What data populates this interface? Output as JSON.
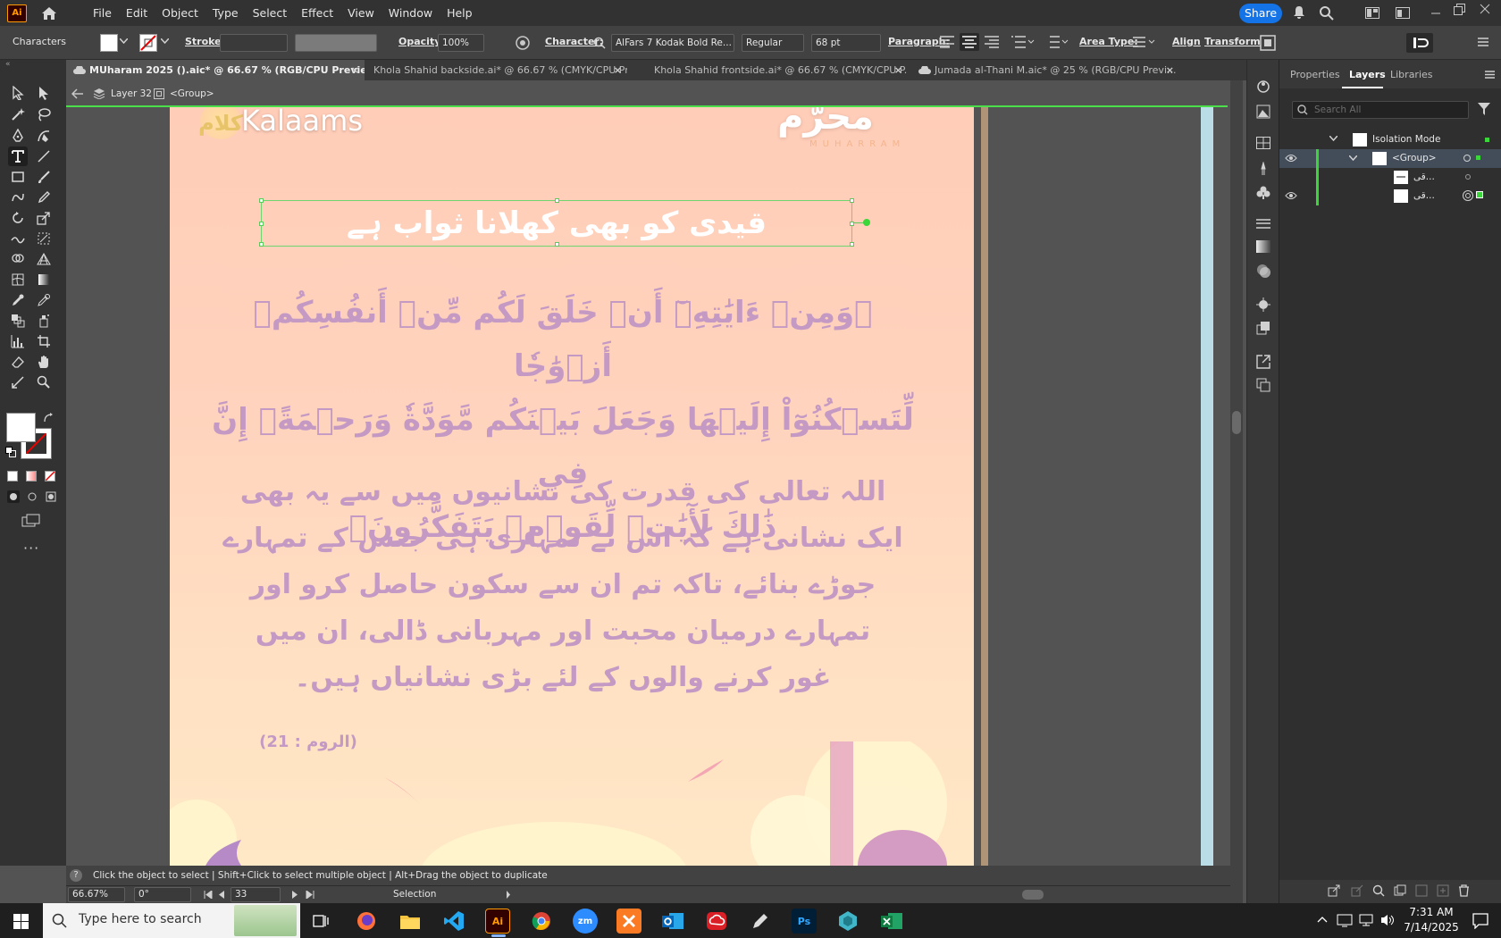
{
  "app": {
    "logo_text": "Ai"
  },
  "menu": [
    "File",
    "Edit",
    "Object",
    "Type",
    "Select",
    "Effect",
    "View",
    "Window",
    "Help"
  ],
  "share_label": "Share",
  "control_bar": {
    "panel_label": "Characters",
    "stroke_label": "Stroke:",
    "opacity_label": "Opacity:",
    "opacity_value": "100%",
    "character_label": "Character:",
    "font_name": "AlFars 7 Kodak Bold Re...",
    "font_style": "Regular",
    "font_size": "68 pt",
    "paragraph_label": "Paragraph:",
    "area_type_label": "Area Type:",
    "align_label": "Align",
    "transform_label": "Transform"
  },
  "tabs": [
    {
      "label": "MUharam 2025 ().aic* @ 66.67 % (RGB/CPU Preview)",
      "active": true
    },
    {
      "label": "Khola Shahid backside.ai* @ 66.67 % (CMYK/CPU Pr...",
      "active": false
    },
    {
      "label": "Khola Shahid frontside.ai* @ 66.67 % (CMYK/CPU P...",
      "active": false
    },
    {
      "label": "Jumada al-Thani M.aic* @ 25 % (RGB/CPU Previ...",
      "active": false
    }
  ],
  "breadcrumb": {
    "layer": "Layer 32",
    "group": "<Group>"
  },
  "artboard": {
    "brand": "Kalaams",
    "brand_urdu": "کلام",
    "month_urdu": "محرّم",
    "month_latin": "MUHARRAM",
    "headline": "قیدی کو بھی کھلانا ثواب ہے",
    "ayah_lines": [
      "﴿وَمِنۡ ءَایَٰتِهِۦٓ أَنۡ خَلَقَ لَكُم مِّنۡ أَنفُسِكُمۡ أَزۡوَٰجٗا",
      "لِّتَسۡكُنُوٓاْ إِلَيۡهَا وَجَعَلَ بَيۡنَكُم مَّوَدَّةٗ وَرَحۡمَةًۚ إِنَّ فِي",
      "ذَٰلِكَ لَأٓيَٰتٖ لِّقَوۡمٖ يَتَفَكَّرُونَ﴾"
    ],
    "translation_lines": [
      "اللہ تعالی کی قدرت کی نشانیوں میں سے یہ بھی",
      "ایک نشانی ہے کہ اس نے تمہاری ہی جنس کے تمہارے",
      "جوڑے بنائے، تاکہ تم ان سے سکون حاصل کرو اور",
      "تمہارے درمیان محبت اور مہربانی ڈالی، ان میں",
      "غور کرنے والوں کے لئے بڑی نشانیاں ہیں۔"
    ],
    "reference": "(الروم : 21)",
    "colors": {
      "headline": "#ffffff",
      "verse": "#c49ac4",
      "bg_top": "#ffcdb8",
      "bg_bottom": "#ffe8c6"
    }
  },
  "status": {
    "hint": "Click the object to select  |  Shift+Click to select multiple object  |  Alt+Drag the object to duplicate",
    "zoom": "66.67%",
    "rotation": "0°",
    "page": "33",
    "tool": "Selection"
  },
  "panel": {
    "tabs": [
      "Properties",
      "Layers",
      "Libraries"
    ],
    "active_tab": "Layers",
    "search_placeholder": "Search All",
    "layers": [
      {
        "name": "Isolation Mode"
      },
      {
        "name": "<Group>"
      },
      {
        "name": "قی..."
      },
      {
        "name": "قی..."
      }
    ]
  },
  "taskbar": {
    "search_placeholder": "Type here to search",
    "time": "7:31 AM",
    "date": "7/14/2025",
    "apps": [
      "firefox-icon",
      "file-explorer-icon",
      "vscode-icon",
      "illustrator-icon",
      "chrome-icon",
      "zoom-icon",
      "xampp-icon",
      "outlook-icon",
      "creative-cloud-icon",
      "pen-tool-icon",
      "photoshop-icon",
      "app-icon",
      "excel-icon"
    ]
  }
}
